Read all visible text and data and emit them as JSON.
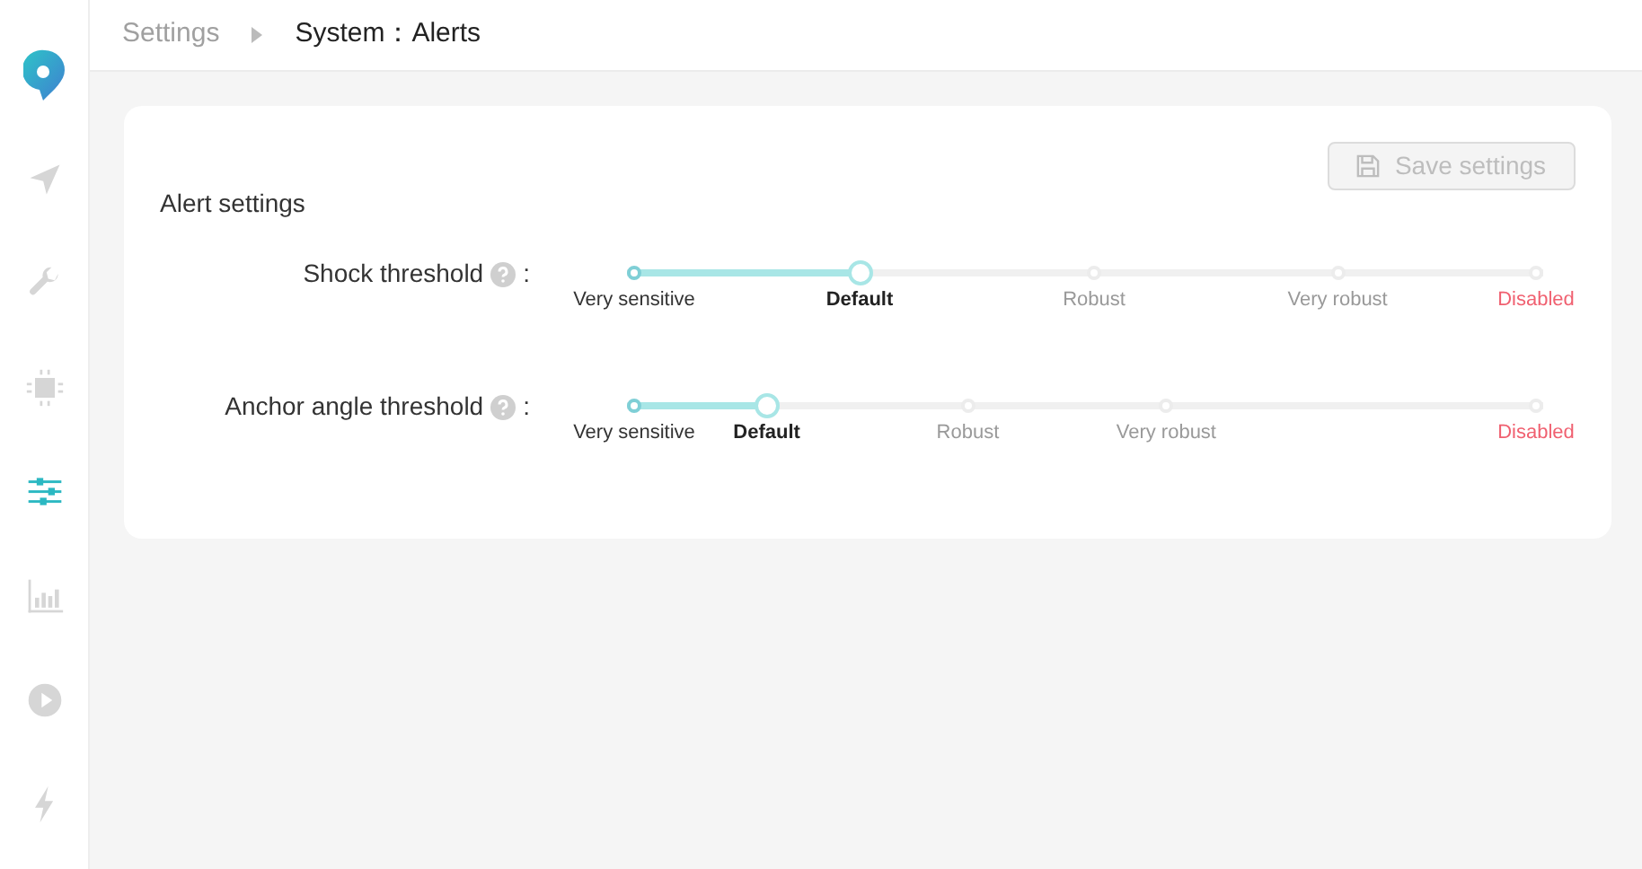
{
  "sidebar": {
    "items": [
      {
        "kind": "navigate",
        "selected": false
      },
      {
        "kind": "wrench",
        "selected": false
      },
      {
        "kind": "chip",
        "selected": false
      },
      {
        "kind": "sliders",
        "selected": true
      },
      {
        "kind": "chart",
        "selected": false
      },
      {
        "kind": "play",
        "selected": false
      },
      {
        "kind": "bolt",
        "selected": false
      }
    ]
  },
  "breadcrumb": {
    "items": [
      "Settings",
      "System：Alerts"
    ]
  },
  "card": {
    "title": "Alert settings",
    "save_button": {
      "label": "Save settings",
      "disabled": true
    },
    "rows": [
      {
        "label": "Shock threshold",
        "suffix": ":",
        "level": 0.25,
        "marks": [
          {
            "label": "Very sensitive",
            "level": 0,
            "selected": false,
            "kind": "normal"
          },
          {
            "label": "Default",
            "level": 0.25,
            "selected": true,
            "kind": "normal"
          },
          {
            "label": "Robust",
            "level": 0.51,
            "selected": false,
            "kind": "normal"
          },
          {
            "label": "Very robust",
            "level": 0.78,
            "selected": false,
            "kind": "normal"
          },
          {
            "label": "Disabled",
            "level": 1,
            "selected": false,
            "kind": "disabled"
          }
        ]
      },
      {
        "label": "Anchor angle threshold",
        "suffix": ":",
        "level": 0.147,
        "marks": [
          {
            "label": "Very sensitive",
            "level": 0,
            "selected": false,
            "kind": "normal"
          },
          {
            "label": "Default",
            "level": 0.147,
            "selected": true,
            "kind": "normal"
          },
          {
            "label": "Robust",
            "level": 0.37,
            "selected": false,
            "kind": "normal"
          },
          {
            "label": "Very robust",
            "level": 0.59,
            "selected": false,
            "kind": "normal"
          },
          {
            "label": "Disabled",
            "level": 1,
            "selected": false,
            "kind": "disabled"
          }
        ]
      }
    ]
  }
}
